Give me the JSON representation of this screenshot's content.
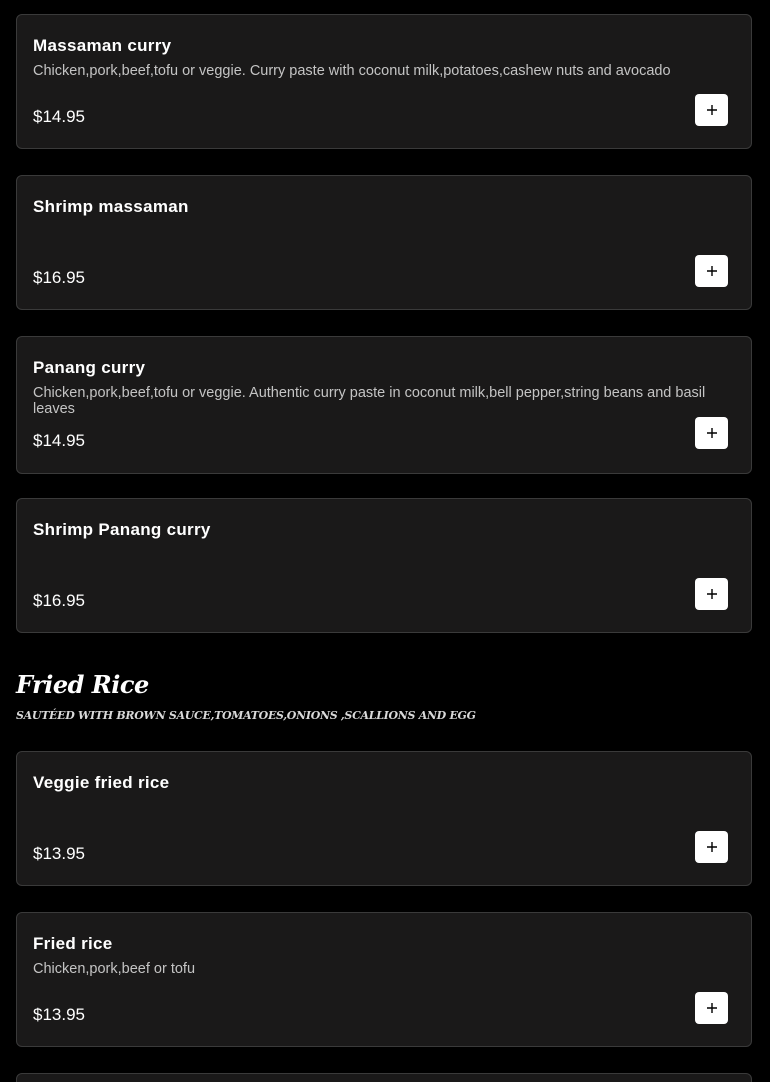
{
  "curry_items": [
    {
      "name": "Massaman curry",
      "description": "Chicken,pork,beef,tofu or veggie. Curry paste with coconut milk,potatoes,cashew nuts and avocado",
      "price": "$14.95"
    },
    {
      "name": "Shrimp massaman",
      "description": "",
      "price": "$16.95"
    },
    {
      "name": "Panang curry",
      "description": "Chicken,pork,beef,tofu or veggie. Authentic curry paste in coconut milk,bell pepper,string beans and basil leaves",
      "price": "$14.95"
    },
    {
      "name": "Shrimp Panang curry",
      "description": "",
      "price": "$16.95"
    }
  ],
  "fried_rice_section": {
    "title": "Fried Rice",
    "description": "SAUTÉED WITH BROWN SAUCE,TOMATOES,ONIONS ,SCALLIONS AND EGG",
    "items": [
      {
        "name": "Veggie fried rice",
        "description": "",
        "price": "$13.95"
      },
      {
        "name": "Fried rice",
        "description": "Chicken,pork,beef or tofu",
        "price": "$13.95"
      }
    ]
  },
  "icons": {
    "add": "plus-icon"
  },
  "colors": {
    "background": "#000000",
    "card_background": "#1a1919",
    "card_border": "#3a3a3a",
    "button_background": "#ffffff",
    "description_text": "#c4c4c4"
  }
}
